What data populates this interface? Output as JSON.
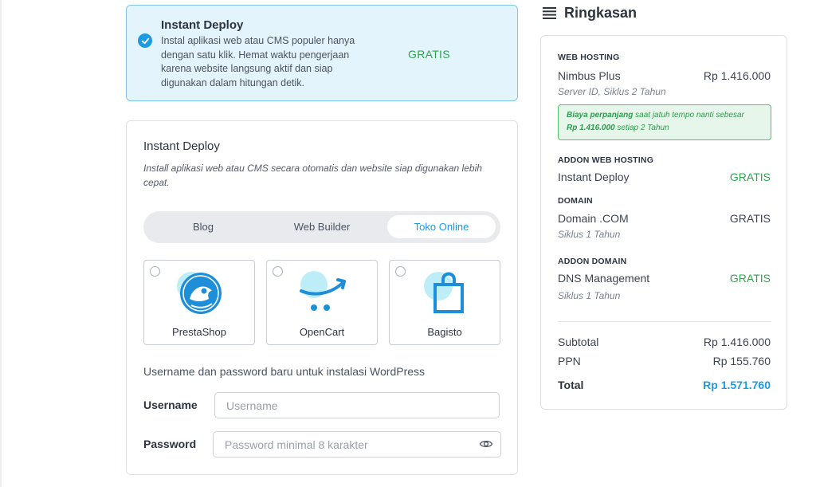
{
  "selected_addon": {
    "title": "Instant Deploy",
    "description": "Instal aplikasi web atau CMS populer hanya dengan satu klik. Hemat waktu pengerjaan karena website langsung aktif dan siap digunakan dalam hitungan detik.",
    "price": "GRATIS",
    "checked": true
  },
  "deploy_panel": {
    "title": "Instant Deploy",
    "description": "Install aplikasi web atau CMS secara otomatis dan website siap digunakan lebih cepat.",
    "tabs": [
      {
        "label": "Blog",
        "active": false
      },
      {
        "label": "Web Builder",
        "active": false
      },
      {
        "label": "Toko Online",
        "active": true
      }
    ],
    "apps": [
      {
        "name": "PrestaShop",
        "icon": "prestashop-icon"
      },
      {
        "name": "OpenCart",
        "icon": "opencart-cart-icon"
      },
      {
        "name": "Bagisto",
        "icon": "bagisto-bag-icon"
      }
    ],
    "credentials_note": "Username dan password baru untuk instalasi WordPress",
    "username": {
      "label": "Username",
      "placeholder": "Username",
      "value": ""
    },
    "password": {
      "label": "Password",
      "placeholder": "Password minimal 8 karakter",
      "value": ""
    }
  },
  "summary": {
    "title": "Ringkasan",
    "icon": "list-icon",
    "hosting": {
      "category": "WEB HOSTING",
      "name": "Nimbus Plus",
      "price": "Rp 1.416.000",
      "detail": "Server ID, Siklus 2 Tahun",
      "renewal_prefix": "Biaya perpanjang",
      "renewal_middle": "saat jatuh tempo nanti sebesar",
      "renewal_amount": "Rp 1.416.000",
      "renewal_suffix": "setiap 2 Tahun"
    },
    "addon_hosting": {
      "category": "ADDON WEB HOSTING",
      "name": "Instant Deploy",
      "price": "GRATIS"
    },
    "domain": {
      "category": "DOMAIN",
      "name": "Domain .COM",
      "price": "GRATIS",
      "detail": "Siklus 1 Tahun"
    },
    "addon_domain": {
      "category": "ADDON DOMAIN",
      "name": "DNS Management",
      "price": "GRATIS",
      "detail": "Siklus 1 Tahun"
    },
    "subtotal_label": "Subtotal",
    "subtotal": "Rp 1.416.000",
    "tax_label": "PPN",
    "tax": "Rp 155.760",
    "total_label": "Total",
    "total": "Rp 1.571.760"
  },
  "colors": {
    "accent": "#1f9ae0",
    "success": "#2ea44f",
    "selected_bg": "#e4f4fc"
  }
}
